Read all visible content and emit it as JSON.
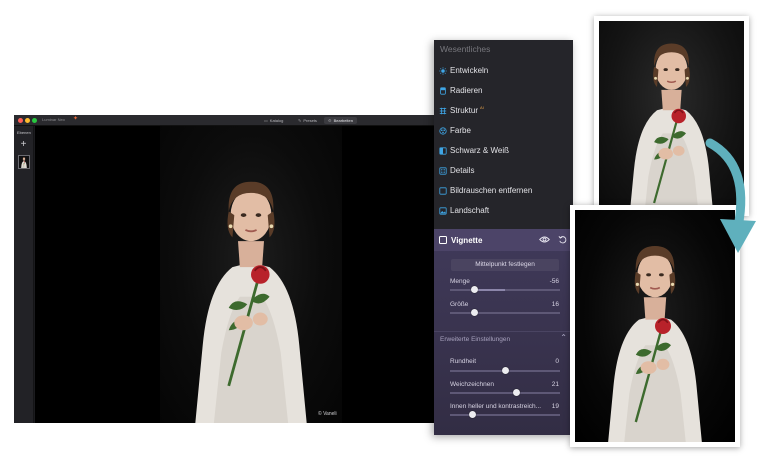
{
  "window": {
    "app_name": "Luminar Neo",
    "tabs": [
      {
        "label": "Katalog"
      },
      {
        "label": "Presets"
      },
      {
        "label": "Bearbeiten"
      }
    ]
  },
  "layers": {
    "title": "Ebenen",
    "add_symbol": "+"
  },
  "canvas": {
    "copyright": "© Vaneli"
  },
  "panel": {
    "header": "Wesentliches",
    "items": [
      {
        "label": "Entwickeln",
        "icon": "sun-icon"
      },
      {
        "label": "Radieren",
        "icon": "eraser-icon"
      },
      {
        "label": "Struktur",
        "icon": "structure-icon",
        "badge": "AI"
      },
      {
        "label": "Farbe",
        "icon": "palette-icon"
      },
      {
        "label": "Schwarz & Weiß",
        "icon": "black-white-icon"
      },
      {
        "label": "Details",
        "icon": "details-icon"
      },
      {
        "label": "Bildrauschen entfernen",
        "icon": "noise-icon"
      },
      {
        "label": "Landschaft",
        "icon": "landscape-icon"
      }
    ],
    "vignette": {
      "title": "Vignette",
      "set_center_label": "Mittelpunkt festlegen",
      "sliders": [
        {
          "label": "Menge",
          "value": "-56",
          "position": 0.22
        },
        {
          "label": "Größe",
          "value": "16",
          "position": 0.22
        }
      ],
      "advanced": {
        "title": "Erweiterte Einstellungen",
        "sliders": [
          {
            "label": "Rundheit",
            "value": "0",
            "position": 0.5
          },
          {
            "label": "Weichzeichnen",
            "value": "21",
            "position": 0.6
          },
          {
            "label": "Innen heller und kontrastreich...",
            "value": "19",
            "position": 0.2
          }
        ]
      }
    }
  },
  "colors": {
    "panel_bg": "#25252a",
    "vignette_bg": "#403a5a",
    "arrow": "#5fb0bd"
  }
}
